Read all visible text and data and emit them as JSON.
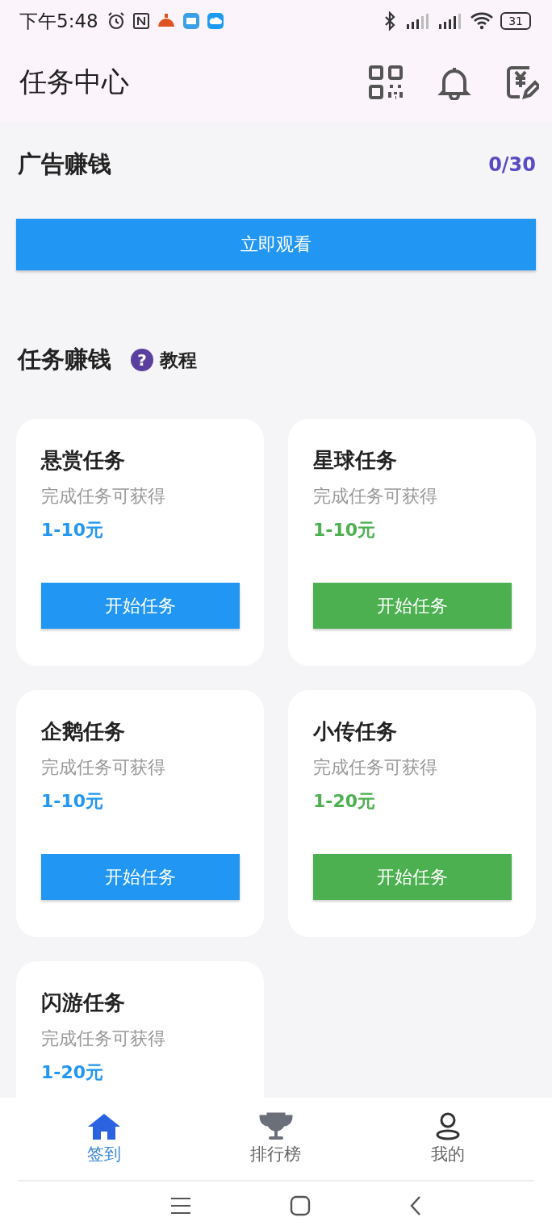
{
  "status_bar": {
    "time": "下午5:48",
    "battery": "31"
  },
  "header": {
    "title": "任务中心"
  },
  "ad_section": {
    "title": "广告赚钱",
    "count": "0/30",
    "button": "立即观看"
  },
  "task_section": {
    "title": "任务赚钱",
    "help_icon": "?",
    "help": "教程"
  },
  "tasks": [
    {
      "title": "悬赏任务",
      "subtitle": "完成任务可获得",
      "reward": "1-10元",
      "button": "开始任务",
      "color": "#2196f3"
    },
    {
      "title": "星球任务",
      "subtitle": "完成任务可获得",
      "reward": "1-10元",
      "button": "开始任务",
      "color": "#4caf50"
    },
    {
      "title": "企鹅任务",
      "subtitle": "完成任务可获得",
      "reward": "1-10元",
      "button": "开始任务",
      "color": "#2196f3"
    },
    {
      "title": "小传任务",
      "subtitle": "完成任务可获得",
      "reward": "1-20元",
      "button": "开始任务",
      "color": "#4caf50"
    },
    {
      "title": "闪游任务",
      "subtitle": "完成任务可获得",
      "reward": "1-20元",
      "color": "#2196f3"
    }
  ],
  "bottom_nav": [
    {
      "label": "签到",
      "kind": "home",
      "selected": true
    },
    {
      "label": "排行榜",
      "kind": "trophy",
      "selected": false
    },
    {
      "label": "我的",
      "kind": "user",
      "selected": false
    }
  ]
}
